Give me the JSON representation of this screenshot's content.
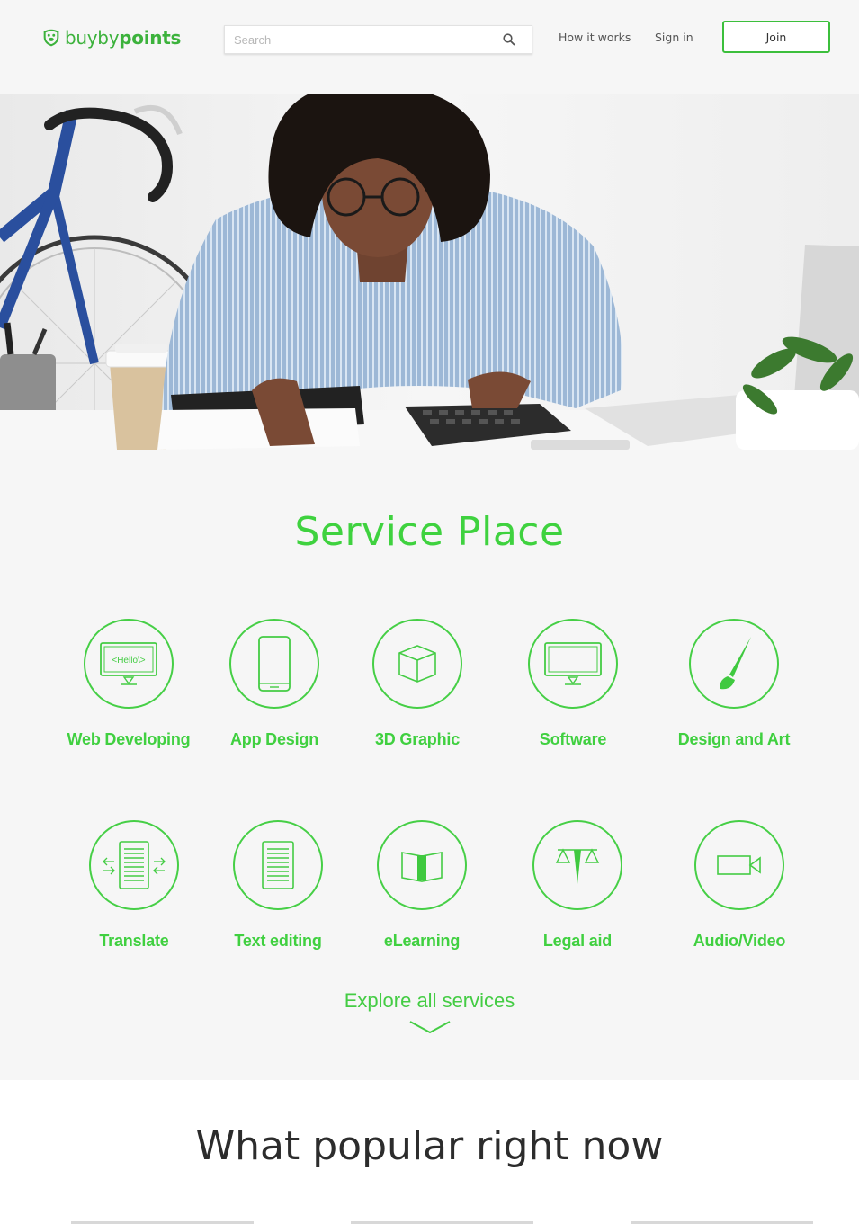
{
  "header": {
    "logo": {
      "text_light": "buyby",
      "text_bold": "points",
      "icon": "paw-badge-icon"
    },
    "search": {
      "placeholder": "Search",
      "icon": "search-icon"
    },
    "nav": {
      "how_it_works": "How it works",
      "sign_in": "Sign in",
      "join": "Join"
    }
  },
  "hero": {
    "image": "woman-working-with-calculator-photo"
  },
  "services": {
    "title": "Service Place",
    "items": [
      {
        "label": "Web Developing",
        "icon": "web-developing-icon",
        "icon_text": "<Hello\\>"
      },
      {
        "label": "App Design",
        "icon": "app-design-icon"
      },
      {
        "label": "3D Graphic",
        "icon": "3d-graphic-icon"
      },
      {
        "label": "Software",
        "icon": "software-icon"
      },
      {
        "label": "Design and Art",
        "icon": "design-and-art-icon"
      },
      {
        "label": "Translate",
        "icon": "translate-icon"
      },
      {
        "label": "Text editing",
        "icon": "text-editing-icon"
      },
      {
        "label": "eLearning",
        "icon": "elearning-icon"
      },
      {
        "label": "Legal aid",
        "icon": "legal-aid-icon"
      },
      {
        "label": "Audio/Video",
        "icon": "audio-video-icon"
      }
    ],
    "explore": {
      "label": "Explore all services",
      "icon": "chevron-down-icon"
    }
  },
  "popular": {
    "title": "What popular right now"
  },
  "colors": {
    "accent": "#3fd23f",
    "logo": "#3cb23c",
    "text_dark": "#2c2c2c"
  }
}
